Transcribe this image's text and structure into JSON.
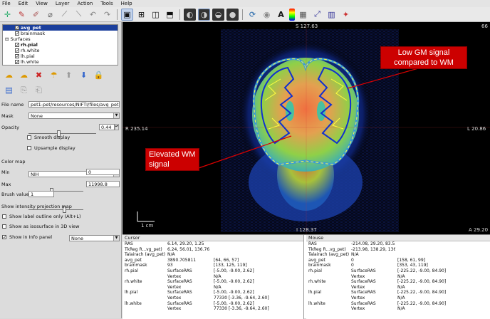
{
  "menu": [
    "File",
    "Edit",
    "View",
    "Layer",
    "Action",
    "Tools",
    "Help"
  ],
  "layers": {
    "items": [
      {
        "name": "avg_pet",
        "checked": true,
        "selected": true,
        "indent": 1
      },
      {
        "name": "brainmask",
        "checked": true,
        "selected": false,
        "indent": 1
      }
    ],
    "surfaces_label": "Surfaces",
    "surfaces": [
      {
        "name": "rh.pial",
        "checked": true,
        "bold": true
      },
      {
        "name": "rh.white",
        "checked": true,
        "bold": false
      },
      {
        "name": "lh.pial",
        "checked": true,
        "bold": false
      },
      {
        "name": "lh.white",
        "checked": true,
        "bold": false
      }
    ]
  },
  "props": {
    "file_name_label": "File name",
    "file_name": "pet1-pet/resources/NIFTI/files/avg_pet.nii",
    "mask_label": "Mask",
    "mask_value": "None",
    "opacity_label": "Opacity",
    "opacity_value": "0.44",
    "opacity_fraction": 0.44,
    "smooth_label": "Smooth display",
    "upsample_label": "Upsample display",
    "colormap_label": "Color map",
    "colormap_value": "NIH",
    "min_label": "Min",
    "min_value": "0",
    "max_label": "Max",
    "max_value": "11998.8",
    "brush_label": "Brush value",
    "brush_value": "1",
    "intensity_label": "Show intensity projection map",
    "intensity_value": "None",
    "outline_label": "Show label outline only (Alt+L)",
    "isosurface_label": "Show as isosurface in 3D view",
    "infopanel_label": "Show in Info panel"
  },
  "view": {
    "top": "S 127.63",
    "right": "L 20.86",
    "left": "R 235.14",
    "bottom": "I 128.37",
    "bottom_right": "A 29.20",
    "top_right": "66",
    "scale": "1 cm"
  },
  "annotations": {
    "gm": "Low GM signal compared to WM",
    "wm": "Elevated WM signal"
  },
  "cursor_panel": {
    "title": "Cursor",
    "rows": [
      [
        "RAS",
        "6.14, 29.20, 1.25",
        ""
      ],
      [
        "TkReg R...vg_pet)",
        "6.24, 56.01, 136.76",
        ""
      ],
      [
        "Talairach (avg_pet)",
        "N/A",
        ""
      ],
      [
        "avg_pet",
        "3890.705811",
        "[64, 66, 57]"
      ],
      [
        "brainmask",
        "93",
        "[133, 125, 119]"
      ],
      [
        "rh.pial",
        "SurfaceRAS",
        "[-5.00, -9.00, 2.62]"
      ],
      [
        "",
        "Vertex",
        "N/A"
      ],
      [
        "rh.white",
        "SurfaceRAS",
        "[-5.00, -9.00, 2.62]"
      ],
      [
        "",
        "Vertex",
        "N/A"
      ],
      [
        "lh.pial",
        "SurfaceRAS",
        "[-5.00, -9.00, 2.62]"
      ],
      [
        "",
        "Vertex",
        "77330  [-3.36, -9.64, 2.60]"
      ],
      [
        "lh.white",
        "SurfaceRAS",
        "[-5.00, -9.00, 2.62]"
      ],
      [
        "",
        "Vertex",
        "77330  [-3.36, -9.64, 2.60]"
      ]
    ]
  },
  "mouse_panel": {
    "title": "Mouse",
    "rows": [
      [
        "RAS",
        "-214.08, 29.20, 83.53",
        ""
      ],
      [
        "TkReg R...vg_pet)",
        "-213.98, 138.29, 136.76",
        ""
      ],
      [
        "Talairach (avg_pet)",
        "N/A",
        ""
      ],
      [
        "avg_pet",
        "0",
        "[158, 61, 99]"
      ],
      [
        "brainmask",
        "0",
        "[353, 43, 119]"
      ],
      [
        "rh.pial",
        "SurfaceRAS",
        "[-225.22, -9.00, 84.90]"
      ],
      [
        "",
        "Vertex",
        "N/A"
      ],
      [
        "rh.white",
        "SurfaceRAS",
        "[-225.22, -9.00, 84.90]"
      ],
      [
        "",
        "Vertex",
        "N/A"
      ],
      [
        "lh.pial",
        "SurfaceRAS",
        "[-225.22, -9.00, 84.90]"
      ],
      [
        "",
        "Vertex",
        "N/A"
      ],
      [
        "lh.white",
        "SurfaceRAS",
        "[-225.22, -9.00, 84.90]"
      ],
      [
        "",
        "Vertex",
        "N/A"
      ]
    ]
  }
}
